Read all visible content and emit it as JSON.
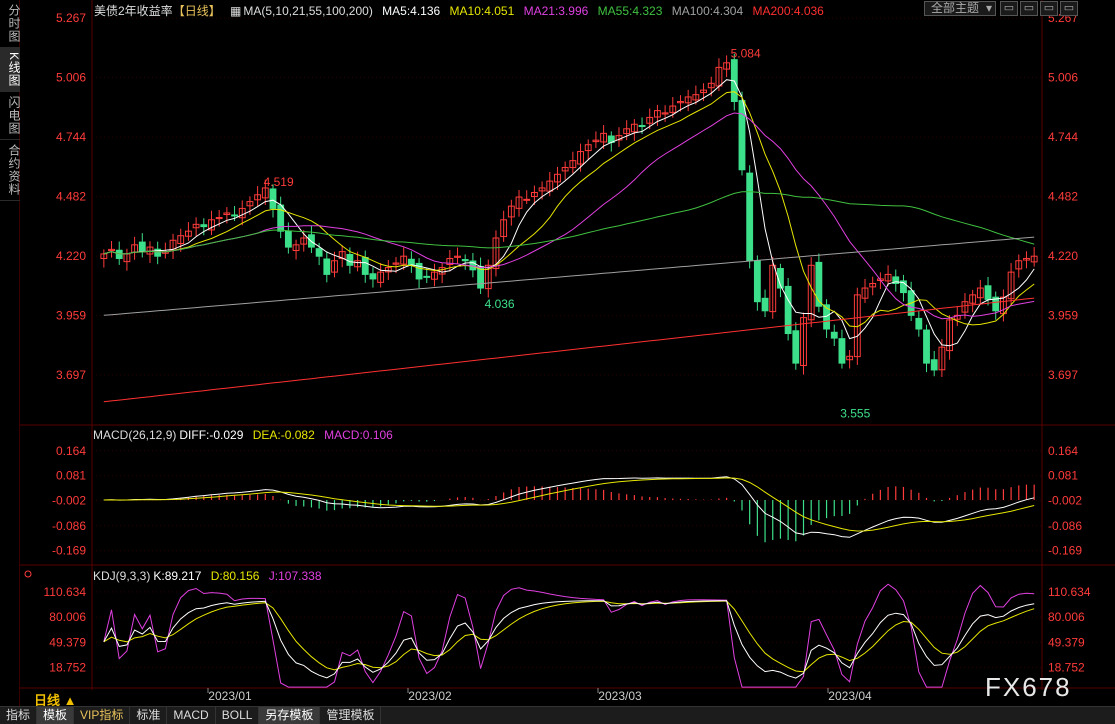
{
  "sidebar": {
    "tabs": [
      {
        "label": "分时图",
        "active": false
      },
      {
        "label": "K线图",
        "active": true
      },
      {
        "label": "闪电图",
        "active": false
      },
      {
        "label": "合约资料",
        "active": false
      }
    ]
  },
  "main_legend": {
    "title": "美债2年收益率",
    "period": "【日线】",
    "ma_params": "MA(5,10,21,55,100,200)",
    "items": [
      {
        "label": "MA5:4.136",
        "color": "#ffffff"
      },
      {
        "label": "MA10:4.051",
        "color": "#e6e600"
      },
      {
        "label": "MA21:3.996",
        "color": "#e040e0"
      },
      {
        "label": "MA55:4.323",
        "color": "#40c040"
      },
      {
        "label": "MA100:4.304",
        "color": "#a0a0a0"
      },
      {
        "label": "MA200:4.036",
        "color": "#ff3030"
      }
    ]
  },
  "theme_dropdown": {
    "label": "全部主题"
  },
  "window_buttons": [
    "▭",
    "▭",
    "▭",
    "▭"
  ],
  "price_axis": {
    "ticks": [
      "5.267",
      "5.006",
      "4.744",
      "4.482",
      "4.220",
      "3.959",
      "3.697"
    ],
    "min": 3.5,
    "max": 5.267
  },
  "annotations": {
    "high1": "4.519",
    "low1": "4.036",
    "high2": "5.084",
    "low2": "3.555"
  },
  "macd_legend": {
    "params": "MACD(26,12,9)",
    "diff": "DIFF:-0.029",
    "dea": "DEA:-0.082",
    "macd": "MACD:0.106"
  },
  "macd_axis": {
    "ticks": [
      "0.164",
      "0.081",
      "-0.002",
      "-0.086",
      "-0.169"
    ]
  },
  "kdj_legend": {
    "params": "KDJ(9,3,3)",
    "k": "K:89.217",
    "d": "D:80.156",
    "j": "J:107.338"
  },
  "kdj_axis": {
    "ticks": [
      "110.634",
      "80.006",
      "49.379",
      "18.752"
    ]
  },
  "date_axis": {
    "labels": [
      "2023/01",
      "2023/02",
      "2023/03",
      "2023/04"
    ]
  },
  "period_label": "日线 ▲",
  "bottom_tabs": [
    {
      "label": "指标",
      "active": false,
      "vip": false
    },
    {
      "label": "模板",
      "active": true,
      "vip": false
    },
    {
      "label": "VIP指标",
      "active": false,
      "vip": true
    },
    {
      "label": "标准",
      "active": false,
      "vip": false
    },
    {
      "label": "MACD",
      "active": false,
      "vip": false
    },
    {
      "label": "BOLL",
      "active": false,
      "vip": false
    },
    {
      "label": "另存模板",
      "active": true,
      "vip": false
    },
    {
      "label": "管理模板",
      "active": false,
      "vip": false
    }
  ],
  "watermark": "FX678",
  "colors": {
    "up": "#ff3b3b",
    "down": "#3de08a",
    "bg": "#000000",
    "grid": "#5a0000"
  },
  "chart_data": {
    "type": "candlestick",
    "title": "美债2年收益率",
    "x": [
      "2023/01",
      "2023/02",
      "2023/03",
      "2023/04"
    ],
    "ylim": [
      3.5,
      5.267
    ],
    "closes": [
      4.23,
      4.25,
      4.21,
      4.23,
      4.27,
      4.24,
      4.26,
      4.22,
      4.24,
      4.29,
      4.31,
      4.33,
      4.36,
      4.35,
      4.38,
      4.39,
      4.41,
      4.4,
      4.43,
      4.46,
      4.49,
      4.52,
      4.43,
      4.33,
      4.26,
      4.27,
      4.3,
      4.26,
      4.22,
      4.14,
      4.2,
      4.24,
      4.18,
      4.2,
      4.14,
      4.12,
      4.15,
      4.17,
      4.19,
      4.22,
      4.18,
      4.12,
      4.13,
      4.15,
      4.17,
      4.21,
      4.22,
      4.2,
      4.16,
      4.08,
      4.18,
      4.3,
      4.38,
      4.44,
      4.48,
      4.47,
      4.5,
      4.52,
      4.55,
      4.58,
      4.61,
      4.64,
      4.68,
      4.71,
      4.73,
      4.76,
      4.72,
      4.75,
      4.78,
      4.8,
      4.79,
      4.83,
      4.86,
      4.85,
      4.88,
      4.9,
      4.92,
      4.93,
      4.95,
      4.98,
      5.05,
      5.07,
      4.9,
      4.6,
      4.2,
      4.02,
      3.98,
      4.18,
      4.08,
      3.88,
      3.75,
      3.95,
      4.18,
      4.0,
      3.9,
      3.86,
      3.75,
      3.78,
      4.05,
      4.08,
      4.1,
      4.12,
      4.14,
      4.1,
      4.06,
      3.96,
      3.9,
      3.75,
      3.72,
      3.82,
      3.94,
      3.96,
      4.02,
      4.05,
      4.08,
      4.03,
      3.98,
      4.04,
      4.15,
      4.2,
      4.21,
      4.22
    ],
    "ma": [
      {
        "name": "MA5",
        "last": 4.136,
        "color": "#ffffff"
      },
      {
        "name": "MA10",
        "last": 4.051,
        "color": "#e6e600"
      },
      {
        "name": "MA21",
        "last": 3.996,
        "color": "#e040e0"
      },
      {
        "name": "MA55",
        "last": 4.323,
        "color": "#40c040"
      },
      {
        "name": "MA100",
        "last": 4.304,
        "color": "#a0a0a0"
      },
      {
        "name": "MA200",
        "last": 4.036,
        "color": "#ff3030"
      }
    ],
    "macd": {
      "diff": -0.029,
      "dea": -0.082,
      "macd": 0.106,
      "ylim": [
        -0.2,
        0.2
      ]
    },
    "kdj": {
      "k": 89.217,
      "d": 80.156,
      "j": 107.338,
      "ylim": [
        0,
        125
      ]
    }
  }
}
